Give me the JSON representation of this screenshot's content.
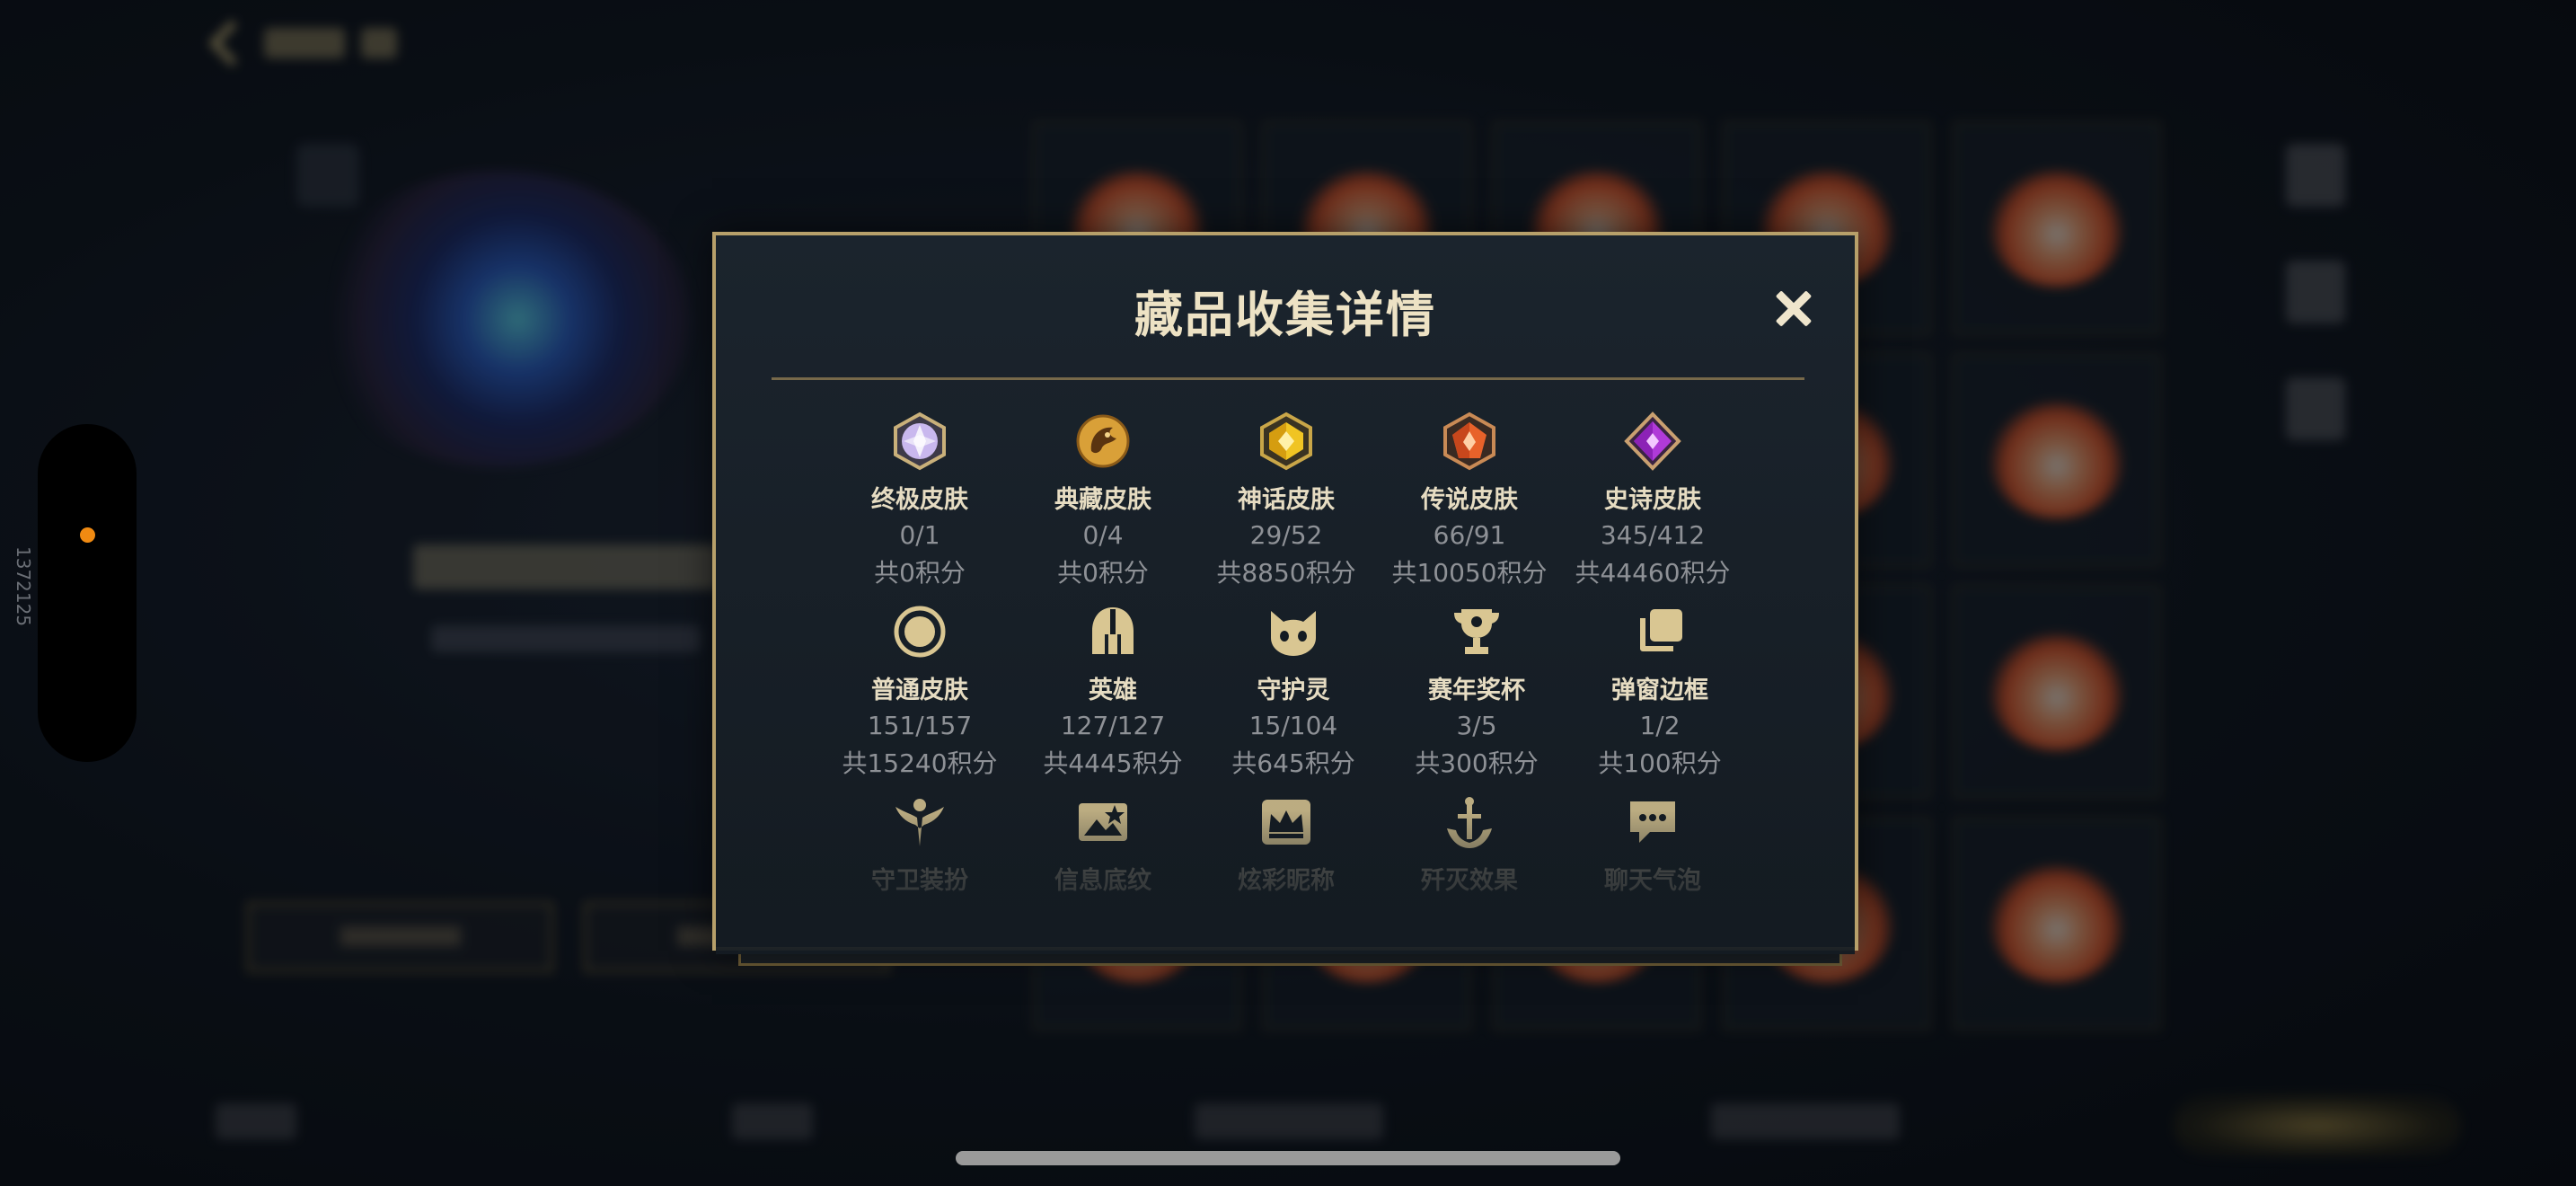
{
  "background": {
    "card_count": 20,
    "side_label": "1372125"
  },
  "dialog": {
    "title": "藏品收集详情",
    "close_icon": "close-icon",
    "rows": [
      [
        {
          "icon": "ultimate-skin-gem-icon",
          "name": "终极皮肤",
          "count": "0/1",
          "score": "共0积分"
        },
        {
          "icon": "prestige-skin-dragon-icon",
          "name": "典藏皮肤",
          "count": "0/4",
          "score": "共0积分"
        },
        {
          "icon": "mythic-skin-gem-icon",
          "name": "神话皮肤",
          "count": "29/52",
          "score": "共8850积分"
        },
        {
          "icon": "legendary-skin-gem-icon",
          "name": "传说皮肤",
          "count": "66/91",
          "score": "共10050积分"
        },
        {
          "icon": "epic-skin-gem-icon",
          "name": "史诗皮肤",
          "count": "345/412",
          "score": "共44460积分"
        }
      ],
      [
        {
          "icon": "common-skin-circle-icon",
          "name": "普通皮肤",
          "count": "151/157",
          "score": "共15240积分"
        },
        {
          "icon": "hero-helmet-icon",
          "name": "英雄",
          "count": "127/127",
          "score": "共4445积分"
        },
        {
          "icon": "guardian-creature-icon",
          "name": "守护灵",
          "count": "15/104",
          "score": "共645积分"
        },
        {
          "icon": "trophy-icon",
          "name": "赛年奖杯",
          "count": "3/5",
          "score": "共300积分"
        },
        {
          "icon": "popup-frame-icon",
          "name": "弹窗边框",
          "count": "1/2",
          "score": "共100积分"
        }
      ],
      [
        {
          "icon": "guardian-outfit-icon",
          "name": "守卫装扮"
        },
        {
          "icon": "info-pattern-icon",
          "name": "信息底纹"
        },
        {
          "icon": "colorful-nickname-crown-icon",
          "name": "炫彩昵称"
        },
        {
          "icon": "annihilation-effect-icon",
          "name": "歼灭效果"
        },
        {
          "icon": "chat-bubble-icon",
          "name": "聊天气泡"
        }
      ]
    ]
  },
  "colors": {
    "gold_border": "#b7a06a",
    "title": "#ede2c4",
    "label": "#e6dcc2",
    "muted": "#8e9196",
    "icon_gold": "#d9c692",
    "accent_dot": "#f08a12"
  }
}
